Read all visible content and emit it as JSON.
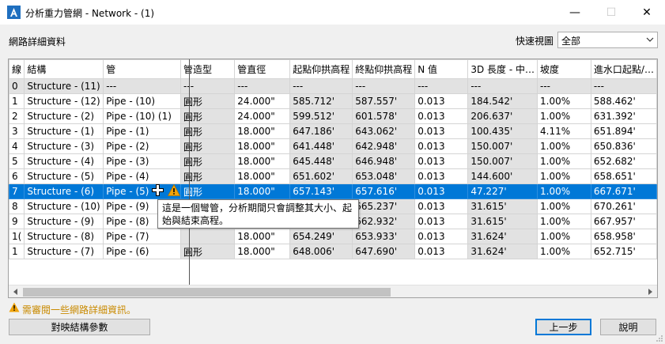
{
  "window": {
    "title": "分析重力管網 - Network - (1)",
    "minimize": "—",
    "maximize": "☐",
    "close": "✕"
  },
  "section_label": "網路詳細資料",
  "quick_view": {
    "label": "快速視圖",
    "value": "全部"
  },
  "table": {
    "columns": [
      "線",
      "結構",
      "管",
      "管造型",
      "管直徑",
      "起點仰拱高程",
      "終點仰拱高程",
      "N 值",
      "3D 長度 - 中…",
      "坡度",
      "進水口起點/…"
    ],
    "rows": [
      [
        "0",
        "Structure - (11)",
        "---",
        "---",
        "---",
        "---",
        "---",
        "---",
        "---",
        "---",
        "---"
      ],
      [
        "1",
        "Structure - (12)",
        "Pipe - (10)",
        "圓形",
        "24.000\"",
        "585.712'",
        "587.557'",
        "0.013",
        "184.542'",
        "1.00%",
        "588.462'"
      ],
      [
        "2",
        "Structure - (2)",
        "Pipe - (10) (1)",
        "圓形",
        "24.000\"",
        "599.512'",
        "601.578'",
        "0.013",
        "206.637'",
        "1.00%",
        "631.392'"
      ],
      [
        "3",
        "Structure - (1)",
        "Pipe - (1)",
        "圓形",
        "18.000\"",
        "647.186'",
        "643.062'",
        "0.013",
        "100.435'",
        "4.11%",
        "651.894'"
      ],
      [
        "4",
        "Structure - (3)",
        "Pipe - (2)",
        "圓形",
        "18.000\"",
        "641.448'",
        "642.948'",
        "0.013",
        "150.007'",
        "1.00%",
        "650.836'"
      ],
      [
        "5",
        "Structure - (4)",
        "Pipe - (3)",
        "圓形",
        "18.000\"",
        "645.448'",
        "646.948'",
        "0.013",
        "150.007'",
        "1.00%",
        "652.682'"
      ],
      [
        "6",
        "Structure - (5)",
        "Pipe - (4)",
        "圓形",
        "18.000\"",
        "651.602'",
        "653.048'",
        "0.013",
        "144.600'",
        "1.00%",
        "658.651'"
      ],
      [
        "7",
        "Structure - (6)",
        "Pipe - (5)",
        "圓形",
        "18.000\"",
        "657.143'",
        "657.616'",
        "0.013",
        "47.227'",
        "1.00%",
        "667.671'"
      ],
      [
        "8",
        "Structure - (10)",
        "Pipe - (9)",
        "",
        "",
        "",
        "665.237'",
        "0.013",
        "31.615'",
        "1.00%",
        "670.261'"
      ],
      [
        "9",
        "Structure - (9)",
        "Pipe - (8)",
        "",
        "",
        "",
        "662.932'",
        "0.013",
        "31.615'",
        "1.00%",
        "667.957'"
      ],
      [
        "1(",
        "Structure - (8)",
        "Pipe - (7)",
        "",
        "18.000\"",
        "654.249'",
        "653.933'",
        "0.013",
        "31.624'",
        "1.00%",
        "658.958'"
      ],
      [
        "1",
        "Structure - (7)",
        "Pipe - (6)",
        "圓形",
        "18.000\"",
        "648.006'",
        "647.690'",
        "0.013",
        "31.624'",
        "1.00%",
        "652.715'"
      ]
    ]
  },
  "tooltip_text": "這是一個彎管，分析期間只會調整其大小、起始與結束高程。",
  "review_message": "需審閱一些網路詳細資訊。",
  "buttons": {
    "map_structure_params": "對映結構參數",
    "back": "上一步",
    "help": "說明"
  },
  "colors": {
    "selection": "#0078d7",
    "warning": "#f0a30a",
    "readonly_cell": "#e2e2e2"
  }
}
